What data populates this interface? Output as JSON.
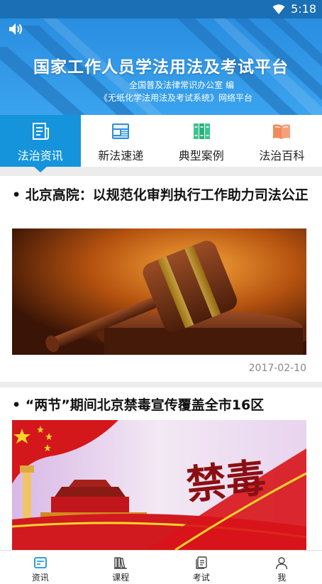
{
  "status_bar": {
    "time": "5:18"
  },
  "banner": {
    "title": "国家工作人员学法用法及考试平台",
    "subtitle_1": "全国普及法律常识办公室 编",
    "subtitle_2": "《无纸化学法用法及考试系统》网络平台"
  },
  "category_tabs": [
    {
      "label": "法治资讯",
      "icon": "newspaper-icon",
      "active": true
    },
    {
      "label": "新法速递",
      "icon": "news-icon",
      "active": false
    },
    {
      "label": "典型案例",
      "icon": "books-icon",
      "active": false
    },
    {
      "label": "法治百科",
      "icon": "open-book-icon",
      "active": false
    }
  ],
  "articles": [
    {
      "title": "•  北京高院：以规范化审判执行工作助力司法公正",
      "image": "gavel-image",
      "date": "2017-02-10"
    },
    {
      "title": "•  “两节”期间北京禁毒宣传覆盖全市16区",
      "image": "anti-drug-banner-image",
      "image_text": "禁毒"
    }
  ],
  "bottom_nav": [
    {
      "label": "资讯",
      "icon": "news-card-icon",
      "active": true
    },
    {
      "label": "课程",
      "icon": "library-icon",
      "active": false
    },
    {
      "label": "考试",
      "icon": "exam-paper-icon",
      "active": false
    },
    {
      "label": "我",
      "icon": "person-icon",
      "active": false
    }
  ],
  "colors": {
    "primary": "#1594dc",
    "banner": "#2a8ee0",
    "status_bar": "#1a6fb5"
  }
}
